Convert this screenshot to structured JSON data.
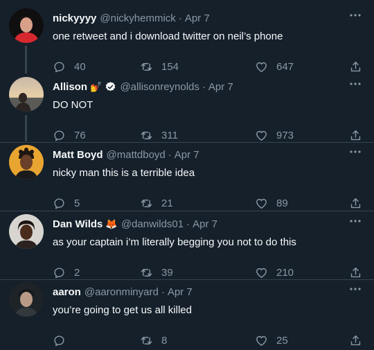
{
  "colors": {
    "background": "#15202b",
    "text": "#f7f9f9",
    "muted": "#8b98a5",
    "verified": "#1d9bf0"
  },
  "icons": {
    "reply": "reply-icon",
    "retweet": "retweet-icon",
    "like": "heart-icon",
    "share": "share-icon",
    "more": "more-icon"
  },
  "tweets": [
    {
      "name": "nickyyyy",
      "handle": "@nickyhemmick",
      "separator": "·",
      "time": "Apr 7",
      "text": "one retweet and i download twitter on neil’s phone",
      "replies": "40",
      "retweets": "154",
      "likes": "647"
    },
    {
      "name": "Allison",
      "name_emoji": "💅",
      "verified": true,
      "handle": "@allisonreynolds",
      "separator": "·",
      "time": "Apr 7",
      "text": "DO NOT",
      "replies": "76",
      "retweets": "311",
      "likes": "973"
    },
    {
      "name": "Matt Boyd",
      "handle": "@mattdboyd",
      "separator": "·",
      "time": "Apr 7",
      "text": "nicky man this is a terrible idea",
      "replies": "5",
      "retweets": "21",
      "likes": "89"
    },
    {
      "name": "Dan Wilds",
      "name_emoji": "🦊",
      "handle": "@danwilds01",
      "separator": "·",
      "time": "Apr 7",
      "text": "as your captain i’m literally begging you not to do this",
      "replies": "2",
      "retweets": "39",
      "likes": "210"
    },
    {
      "name": "aaron",
      "handle": "@aaronminyard",
      "separator": "·",
      "time": "Apr 7",
      "text": "you’re going to get us all killed",
      "replies": "",
      "retweets": "8",
      "likes": "25"
    }
  ]
}
